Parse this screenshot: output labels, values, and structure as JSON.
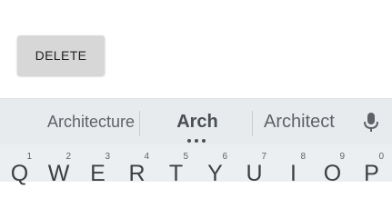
{
  "buttons": {
    "delete_label": "DELETE"
  },
  "keyboard": {
    "suggestions": {
      "left": "Architecture",
      "center": "Arch",
      "right": "Architect"
    },
    "mic_icon": "microphone-icon",
    "keys": [
      {
        "letter": "Q",
        "hint": "1"
      },
      {
        "letter": "W",
        "hint": "2"
      },
      {
        "letter": "E",
        "hint": "3"
      },
      {
        "letter": "R",
        "hint": "4"
      },
      {
        "letter": "T",
        "hint": "5"
      },
      {
        "letter": "Y",
        "hint": "6"
      },
      {
        "letter": "U",
        "hint": "7"
      },
      {
        "letter": "I",
        "hint": "8"
      },
      {
        "letter": "O",
        "hint": "9"
      },
      {
        "letter": "P",
        "hint": "0"
      }
    ]
  },
  "colors": {
    "keyboard_background": "#eceff1",
    "button_background": "#d7d7d7",
    "key_text": "#3c4043"
  }
}
